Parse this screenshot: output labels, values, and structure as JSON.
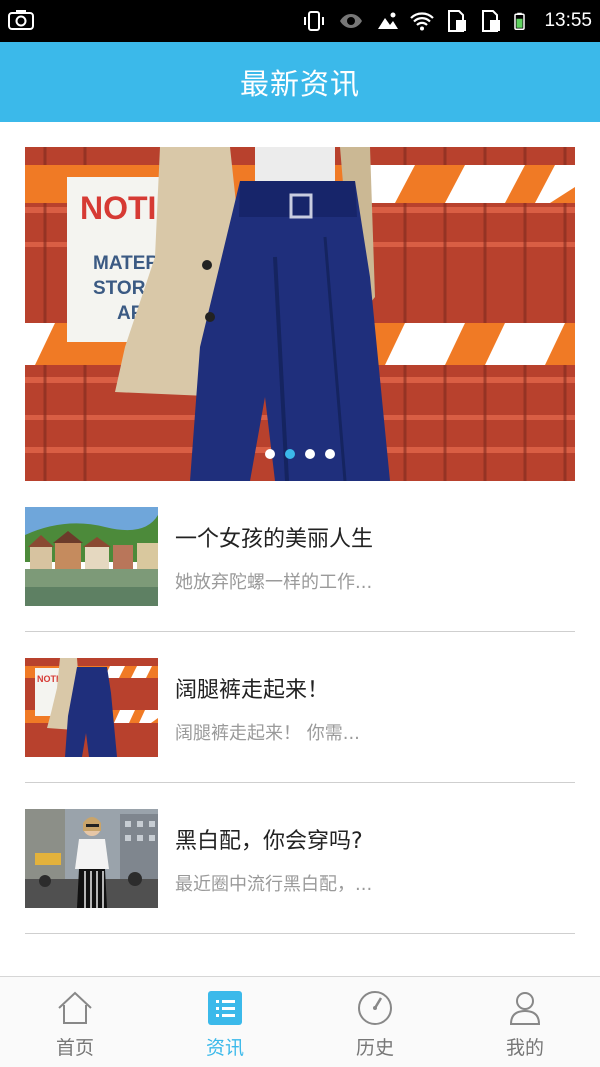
{
  "status_bar": {
    "time": "13:55",
    "icons": [
      "screenshot-icon",
      "vibrate-icon",
      "eye-icon",
      "image-icon",
      "wifi-icon",
      "sim1-icon",
      "sim2-icon",
      "battery-icon"
    ]
  },
  "header": {
    "title": "最新资讯"
  },
  "banner": {
    "slide_count": 4,
    "active_index": 1,
    "sign_text": [
      "NOTICE",
      "MATER",
      "STOR",
      "AR"
    ]
  },
  "news": [
    {
      "title": "一个女孩的美丽人生",
      "desc": "她放弃陀螺一样的工作..."
    },
    {
      "title": "阔腿裤走起来！",
      "desc": "阔腿裤走起来！ 你需..."
    },
    {
      "title": "黑白配，你会穿吗?",
      "desc": "最近圈中流行黑白配，..."
    }
  ],
  "bottom_nav": {
    "items": [
      {
        "label": "首页",
        "icon": "home-icon"
      },
      {
        "label": "资讯",
        "icon": "news-list-icon"
      },
      {
        "label": "历史",
        "icon": "history-icon"
      },
      {
        "label": "我的",
        "icon": "profile-icon"
      }
    ],
    "active_index": 1
  },
  "colors": {
    "accent": "#3bb9ea",
    "status_bar": "#000000"
  }
}
